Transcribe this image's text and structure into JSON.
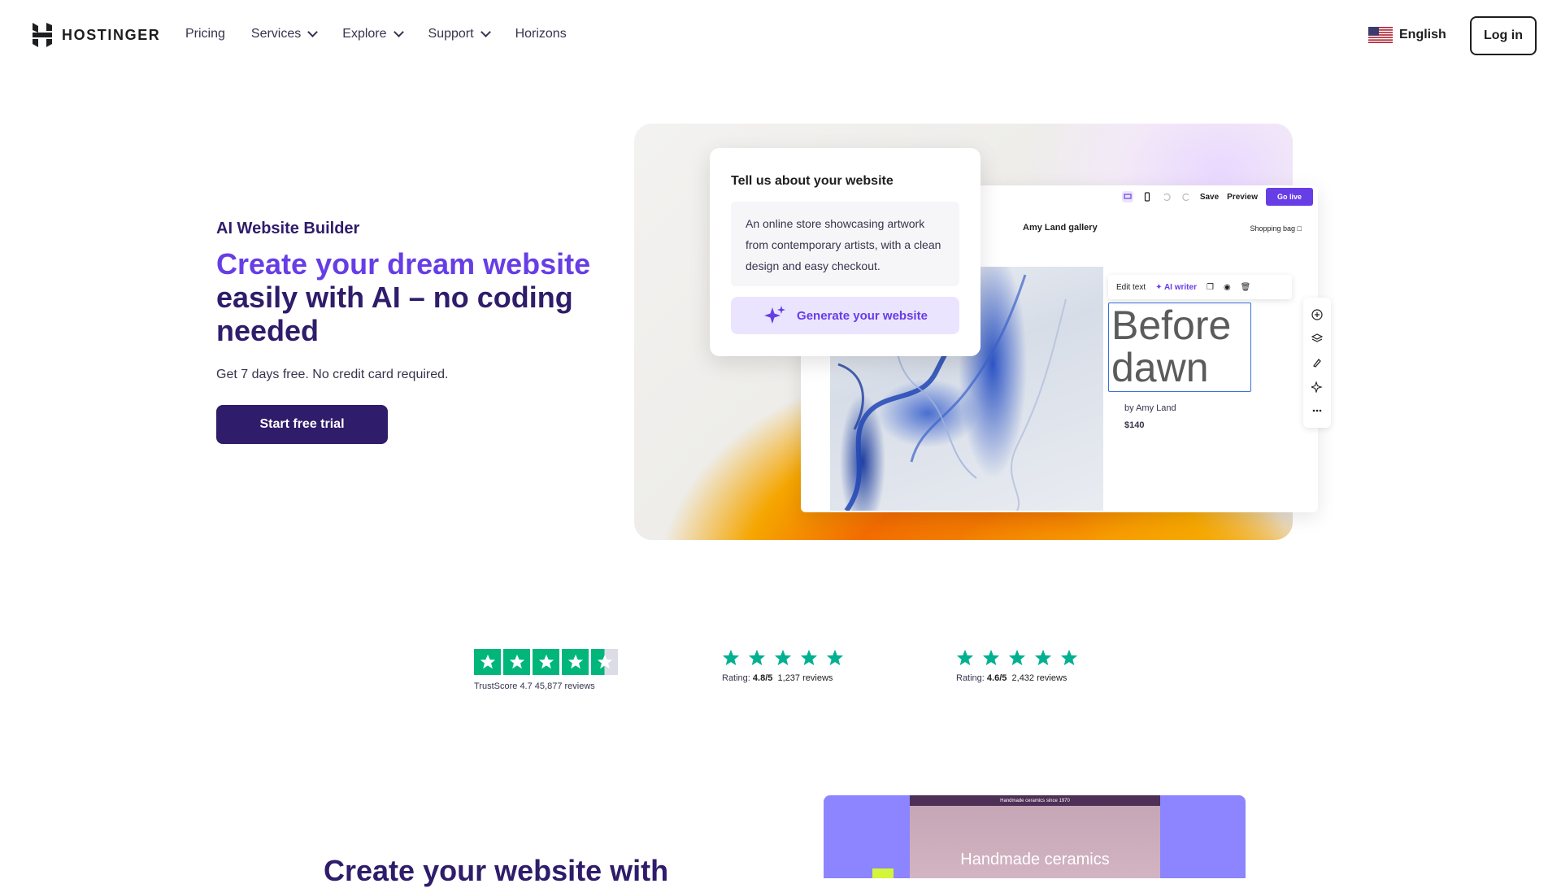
{
  "nav": {
    "brand": "HOSTINGER",
    "links": [
      {
        "label": "Pricing",
        "dropdown": false
      },
      {
        "label": "Services",
        "dropdown": true
      },
      {
        "label": "Explore",
        "dropdown": true
      },
      {
        "label": "Support",
        "dropdown": true
      },
      {
        "label": "Horizons",
        "dropdown": false
      }
    ],
    "language": "English",
    "login": "Log in"
  },
  "hero": {
    "eyebrow": "AI Website Builder",
    "headline_highlight": "Create your dream website",
    "headline_rest": " easily with AI – no coding needed",
    "subtext": "Get 7 days free. No credit card required.",
    "cta": "Start free trial",
    "accent_color": "#673de6",
    "primary_color": "#2f1c6a"
  },
  "prompt_card": {
    "title": "Tell us about your website",
    "body": "An online store showcasing artwork from contemporary artists, with a clean design and easy checkout.",
    "button": "Generate your website"
  },
  "editor": {
    "toolbar": {
      "save": "Save",
      "preview": "Preview",
      "go_live": "Go live"
    },
    "site_title": "Amy Land gallery",
    "shopping_bag": "Shopping bag",
    "text_toolbar": {
      "edit_text": "Edit text",
      "ai_writer": "AI writer"
    },
    "artwork_title": "Before dawn",
    "artist": "by Amy Land",
    "price": "$140"
  },
  "ratings": [
    {
      "source": "Trustpilot",
      "label": "TrustScore 4.7",
      "reviews": "45,877 reviews",
      "stars": 4.5
    },
    {
      "prefix": "Rating:",
      "score": "4.8/5",
      "reviews": "1,237 reviews",
      "stars": 5
    },
    {
      "prefix": "Rating:",
      "score": "4.6/5",
      "reviews": "2,432 reviews",
      "stars": 5
    }
  ],
  "section2": {
    "title": "Create your website with",
    "preview_title": "Handmade ceramics",
    "preview_topbar": "Handmade ceramics since 1970"
  }
}
